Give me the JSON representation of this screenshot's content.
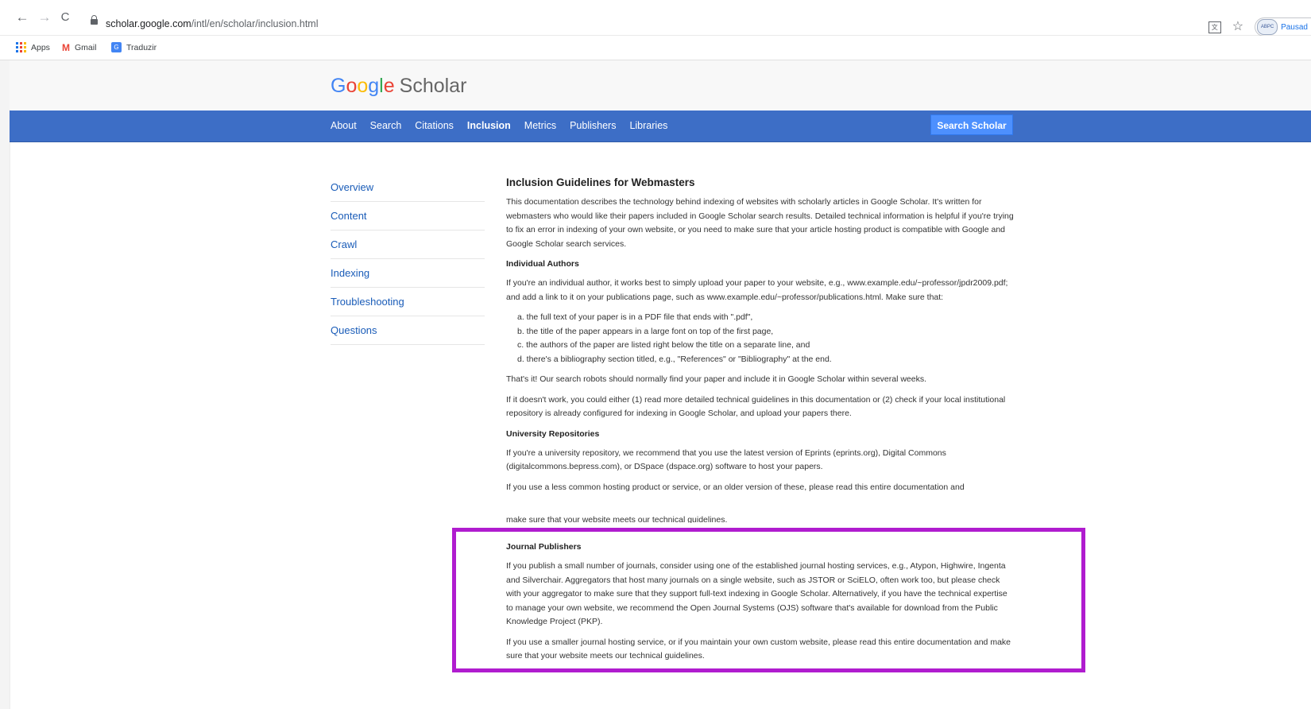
{
  "browser": {
    "back_glyph": "←",
    "forward_glyph": "→",
    "reload_glyph": "C",
    "url_host": "scholar.google.com",
    "url_path": "/intl/en/scholar/inclusion.html",
    "bookmarks": [
      "Apps",
      "Gmail",
      "Traduzir"
    ],
    "profile_label": "Pausad",
    "avatar_text": "ABPC"
  },
  "logo": {
    "g1": "G",
    "o1": "o",
    "o2": "o",
    "g2": "g",
    "l": "l",
    "e": "e",
    "product": "Scholar"
  },
  "nav": {
    "items": [
      "About",
      "Search",
      "Citations",
      "Inclusion",
      "Metrics",
      "Publishers",
      "Libraries"
    ],
    "active": "Inclusion",
    "search_button": "Search Scholar"
  },
  "sidenav": [
    "Overview",
    "Content",
    "Crawl",
    "Indexing",
    "Troubleshooting",
    "Questions"
  ],
  "article": {
    "title": "Inclusion Guidelines for Webmasters",
    "intro": "This documentation describes the technology behind indexing of websites with scholarly articles in Google Scholar. It's written for webmasters who would like their papers included in Google Scholar search results. Detailed technical information is helpful if you're trying to fix an error in indexing of your own website, or you need to make sure that your article hosting product is compatible with Google and Google Scholar search services.",
    "authors_heading": "Individual Authors",
    "authors_p1": "If you're an individual author, it works best to simply upload your paper to your website, e.g., www.example.edu/~professor/jpdr2009.pdf; and add a link to it on your publications page, such as www.example.edu/~professor/publications.html. Make sure that:",
    "list": [
      "a. the full text of your paper is in a PDF file that ends with \".pdf\",",
      "b. the title of the paper appears in a large font on top of the first page,",
      "c. the authors of the paper are listed right below the title on a separate line, and",
      "d. there's a bibliography section titled, e.g., \"References\" or \"Bibliography\" at the end."
    ],
    "authors_p2": "That's it! Our search robots should normally find your paper and include it in Google Scholar within several weeks.",
    "authors_p3": "If it doesn't work, you could either (1) read more detailed technical guidelines in this documentation or (2) check if your local institutional repository is already configured for indexing in Google Scholar, and upload your papers there.",
    "repos_heading": "University Repositories",
    "repos_p1": "If you're a university repository, we recommend that you use the latest version of Eprints (eprints.org), Digital Commons (digitalcommons.bepress.com), or DSpace (dspace.org) software to host your papers.",
    "repos_p2": "If you use a less common hosting product or service, or an older version of these, please read this entire documentation and",
    "repos_p2_clipped": "make sure that your website meets our technical guidelines.",
    "journal_heading": "Journal Publishers",
    "journal_p1": "If you publish a small number of journals, consider using one of the established journal hosting services, e.g., Atypon, Highwire, Ingenta and Silverchair. Aggregators that host many journals on a single website, such as JSTOR or SciELO, often work too, but please check with your aggregator to make sure that they support full-text indexing in Google Scholar. Alternatively, if you have the technical expertise to manage your own website, we recommend the Open Journal Systems (OJS) software that's available for download from the Public Knowledge Project (PKP).",
    "journal_p2": "If you use a smaller journal hosting service, or if you maintain your own custom website, please read this entire documentation and make sure that your website meets our technical guidelines."
  },
  "colors": {
    "navbar": "#3d6ec6",
    "link": "#1a5cb8",
    "highlight": "#b01ccf",
    "search_button": "#4d90fe"
  }
}
